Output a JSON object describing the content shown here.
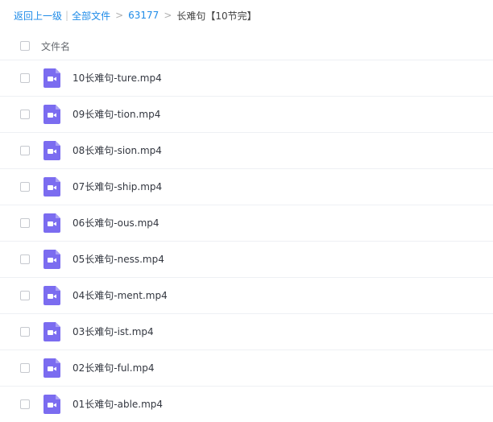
{
  "breadcrumb": {
    "back": "返回上一级",
    "divider": "|",
    "all_files": "全部文件",
    "sep1": ">",
    "folder": "63177",
    "sep2": ">",
    "current": "长难句【10节完】"
  },
  "list": {
    "header": "文件名",
    "icon": "video-file-icon",
    "icon_color": "#7b6cf0",
    "files": [
      {
        "name": "10长难句-ture.mp4"
      },
      {
        "name": "09长难句-tion.mp4"
      },
      {
        "name": "08长难句-sion.mp4"
      },
      {
        "name": "07长难句-ship.mp4"
      },
      {
        "name": "06长难句-ous.mp4"
      },
      {
        "name": "05长难句-ness.mp4"
      },
      {
        "name": "04长难句-ment.mp4"
      },
      {
        "name": "03长难句-ist.mp4"
      },
      {
        "name": "02长难句-ful.mp4"
      },
      {
        "name": "01长难句-able.mp4"
      }
    ]
  }
}
